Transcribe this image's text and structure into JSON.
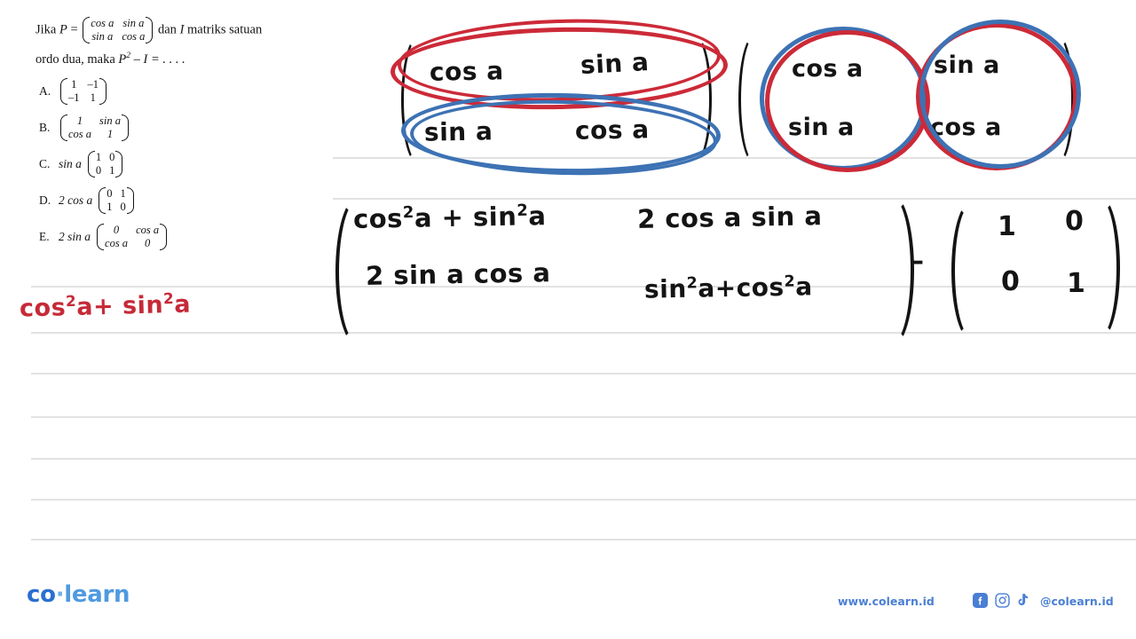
{
  "page": {
    "background": "#ffffff",
    "ruled_line_color": "#e2e2e2"
  },
  "colors": {
    "ink_black": "#141414",
    "ink_red": "#cc2a38",
    "ink_blue": "#3d72b4",
    "brand_blue_dark": "#2a6fd0",
    "brand_blue_light": "#4f9ae0",
    "footer_blue": "#4a7fd4"
  },
  "question": {
    "line1_pre": "Jika",
    "line1_var": "P",
    "line1_eq": "=",
    "matrix_P": {
      "r1c1": "cos a",
      "r1c2": "sin a",
      "r2c1": "sin  a",
      "r2c2": "cos a"
    },
    "line1_post": "dan",
    "line1_I": "I",
    "line1_tail": "matriks satuan",
    "line2_pre": "ordo dua, maka",
    "line2_expr_base": "P",
    "line2_expr_sup": "2",
    "line2_expr_rest": "– I = . . . ."
  },
  "options": [
    {
      "label": "A.",
      "coefficient": "",
      "matrix": {
        "r1c1": "1",
        "r1c2": "–1",
        "r2c1": "–1",
        "r2c2": "1"
      }
    },
    {
      "label": "B.",
      "coefficient": "",
      "matrix": {
        "r1c1": "1",
        "r1c2": "sin a",
        "r2c1": "cos a",
        "r2c2": "1"
      }
    },
    {
      "label": "C.",
      "coefficient": "sin a",
      "matrix": {
        "r1c1": "1",
        "r1c2": "0",
        "r2c1": "0",
        "r2c2": "1"
      }
    },
    {
      "label": "D.",
      "coefficient": "2 cos a",
      "matrix": {
        "r1c1": "0",
        "r1c2": "1",
        "r2c1": "1",
        "r2c2": "0"
      }
    },
    {
      "label": "E.",
      "coefficient": "2 sin a",
      "matrix": {
        "r1c1": "0",
        "r1c2": "cos a",
        "r2c1": "cos a",
        "r2c2": "0"
      }
    }
  ],
  "handwriting": {
    "red_note_left": {
      "base1": "cos",
      "sup1": "2",
      "var1": "a",
      "plus": "+",
      "base2": "sin",
      "sup2": "2",
      "var2": "a",
      "full_text": "cos²a + sin²a"
    },
    "matrix_top_left": {
      "r1c1": "cos a",
      "r1c2": "sin a",
      "r2c1": "sin a",
      "r2c2": "cos a",
      "annotation_row1": "red-ellipse-row-1",
      "annotation_row2": "blue-ellipse-row-2"
    },
    "matrix_top_right": {
      "r1c1": "cos a",
      "r1c2": "sin a",
      "r2c1": "sin a",
      "r2c2": "cos a",
      "annotation_col1": "red-ellipse-column-1",
      "annotation_col2": "blue-ellipse-column-2"
    },
    "result_matrix": {
      "r1c1_base1": "cos",
      "r1c1_sup1": "2",
      "r1c1_var1": "a",
      "r1c1_plus": "+",
      "r1c1_base2": "sin",
      "r1c1_sup2": "2",
      "r1c1_var2": "a",
      "r1c1_full": "cos²a + sin²a",
      "r1c2_full": "2 cos a sin a",
      "r2c1_full": "2 sin a cos a",
      "r2c2_base1": "sin",
      "r2c2_sup1": "2",
      "r2c2_var1": "a",
      "r2c2_plus": "+",
      "r2c2_base2": "cos",
      "r2c2_sup2": "2",
      "r2c2_var2": "a",
      "r2c2_full": "sin²a + cos²a"
    },
    "minus_sign": "–",
    "identity_matrix": {
      "r1c1": "1",
      "r1c2": "0",
      "r2c1": "0",
      "r2c2": "1"
    }
  },
  "footer": {
    "logo_co": "co",
    "logo_dot": "·",
    "logo_learn": "learn",
    "website": "www.colearn.id",
    "handle": "@colearn.id",
    "social_icons": [
      "facebook-icon",
      "instagram-icon",
      "tiktok-icon"
    ]
  }
}
